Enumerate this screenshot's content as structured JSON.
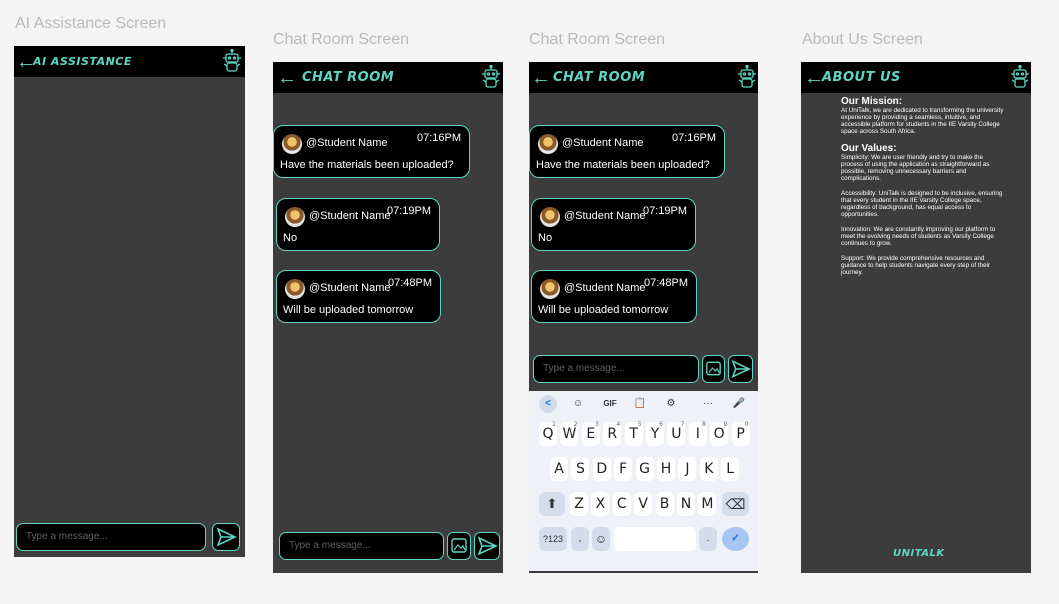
{
  "frames": {
    "ai": "AI Assistance Screen",
    "chat1": "Chat Room Screen",
    "chat2": "Chat Room Screen",
    "about": "About Us Screen"
  },
  "ai_screen": {
    "title": "AI ASSISTANCE",
    "input_placeholder": "Type a message..."
  },
  "chat_screen": {
    "title": "CHAT ROOM",
    "input_placeholder": "Type a message...",
    "messages": [
      {
        "user": "@Student Name",
        "time": "07:16PM",
        "text": "Have the materials been uploaded?"
      },
      {
        "user": "@Student Name",
        "time": "07:19PM",
        "text": "No"
      },
      {
        "user": "@Student Name",
        "time": "07:48PM",
        "text": "Will be uploaded tomorrow"
      }
    ]
  },
  "keyboard": {
    "toolbar": [
      "<",
      "☺",
      "GIF",
      "📋",
      "⚙",
      "···",
      "🎤"
    ],
    "row1": [
      "Q",
      "W",
      "E",
      "R",
      "T",
      "Y",
      "U",
      "I",
      "O",
      "P"
    ],
    "row1_hints": [
      "1",
      "2",
      "3",
      "4",
      "5",
      "6",
      "7",
      "8",
      "9",
      "0"
    ],
    "row2": [
      "A",
      "S",
      "D",
      "F",
      "G",
      "H",
      "J",
      "K",
      "L"
    ],
    "row3": [
      "Z",
      "X",
      "C",
      "V",
      "B",
      "N",
      "M"
    ],
    "shift": "⬆",
    "backspace": "⌫",
    "num_key": "?123",
    "comma": ",",
    "emoji": "☺",
    "period": ".",
    "enter": "✓"
  },
  "about_screen": {
    "title": "ABOUT US",
    "mission_heading": "Our Mission:",
    "mission_text": "At UniTalk, we are dedicated to transforming the university experience by providing a seamless, intuitive, and accessible platform for students in the IIE Varsity College space across South Africa.",
    "values_heading": "Our Values:",
    "values": [
      "Simplicity: We are user friendly and try to make the process of using the application as straightforward as possible, removing unnecessary barriers and complications.",
      "Accessibility: UniTalk is designed to be inclusive, ensuring that every student in the IIE Varsity College space, regardless of background, has equal access to opportunities.",
      "Innovation: We are constantly improving our platform to meet the evolving needs of students as Varsity College continues to grow.",
      "Support: We provide comprehensive resources and guidance to help students navigate every step of their journey."
    ],
    "footer": "UNITALK"
  },
  "colors": {
    "accent": "#5fd6c4",
    "bg": "#3c3c3c",
    "bar": "#000000",
    "blue": "#1a73e8"
  }
}
